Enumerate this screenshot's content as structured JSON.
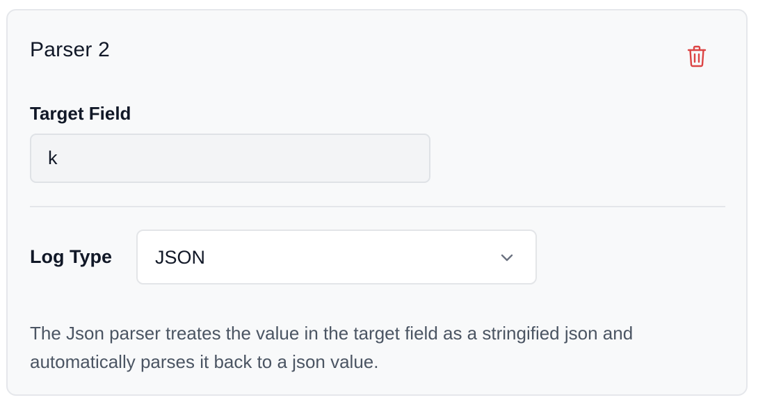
{
  "parser": {
    "title": "Parser 2",
    "delete_icon": "trash-icon",
    "target_field": {
      "label": "Target Field",
      "value": "k"
    },
    "log_type": {
      "label": "Log Type",
      "selected": "JSON",
      "chevron_icon": "chevron-down-icon"
    },
    "description": "The Json parser treates the value in the target field as a stringified json and automatically parses it back to a json value."
  },
  "colors": {
    "card_background": "#f8f9fa",
    "delete_icon": "#dc4444",
    "description_text": "#4b5563"
  }
}
